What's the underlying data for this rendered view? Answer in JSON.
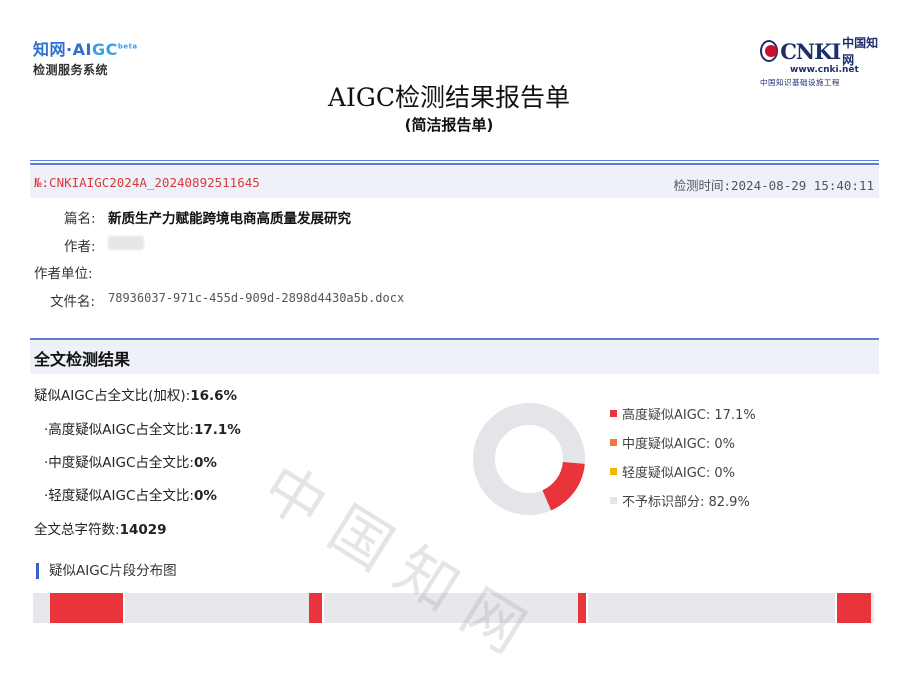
{
  "logo_left": {
    "line1_a": "知网·",
    "line1_ai": "AI",
    "line1_gc": "GC",
    "line1_beta": "beta",
    "line2": "检测服务系统"
  },
  "logo_right": {
    "mark": "CNKI",
    "cn": "中国知网",
    "url": "www.cnki.net",
    "sub": "中国知识基础设施工程"
  },
  "report": {
    "title": "AIGC检测结果报告单",
    "subtitle": "(简洁报告单)",
    "number": "№:CNKIAIGC2024A_20240892511645",
    "check_time": "检测时间:2024-08-29 15:40:11"
  },
  "fields": {
    "title_label": "篇名:",
    "title_value": "新质生产力赋能跨境电商高质量发展研究",
    "author_label": "作者:",
    "org_label": "作者单位:",
    "file_label": "文件名:",
    "file_value": "78936037-971c-455d-909d-2898d4430a5b.docx"
  },
  "section": {
    "title": "全文检测结果"
  },
  "stats": {
    "weighted_label": "疑似AIGC占全文比(加权):",
    "weighted_value": "16.6%",
    "high_label": "·高度疑似AIGC占全文比:",
    "high_value": "17.1%",
    "mid_label": "·中度疑似AIGC占全文比:",
    "mid_value": "0%",
    "low_label": "·轻度疑似AIGC占全文比:",
    "low_value": "0%",
    "total_label": "全文总字符数:",
    "total_value": "14029"
  },
  "donut": {
    "high_percent": 17.1,
    "mid_percent": 0,
    "low_percent": 0,
    "none_percent": 82.9,
    "colors": {
      "high": "#e8343a",
      "mid": "#f07a3a",
      "low": "#f2b705",
      "none": "#e3e5e8"
    }
  },
  "legend": [
    {
      "label": "高度疑似AIGC: 17.1%",
      "color": "#e8343a"
    },
    {
      "label": "中度疑似AIGC: 0%",
      "color": "#f07a3a"
    },
    {
      "label": "轻度疑似AIGC: 0%",
      "color": "#f2b705"
    },
    {
      "label": "不予标识部分: 82.9%",
      "color": "#e3e5e8"
    }
  ],
  "distribution": {
    "title": "疑似AIGC片段分布图",
    "segments": [
      {
        "start": 0.02,
        "end": 0.108
      },
      {
        "start": 0.328,
        "end": 0.344
      },
      {
        "start": 0.648,
        "end": 0.66
      },
      {
        "start": 0.955,
        "end": 0.997
      }
    ]
  },
  "watermark": "中国知网"
}
